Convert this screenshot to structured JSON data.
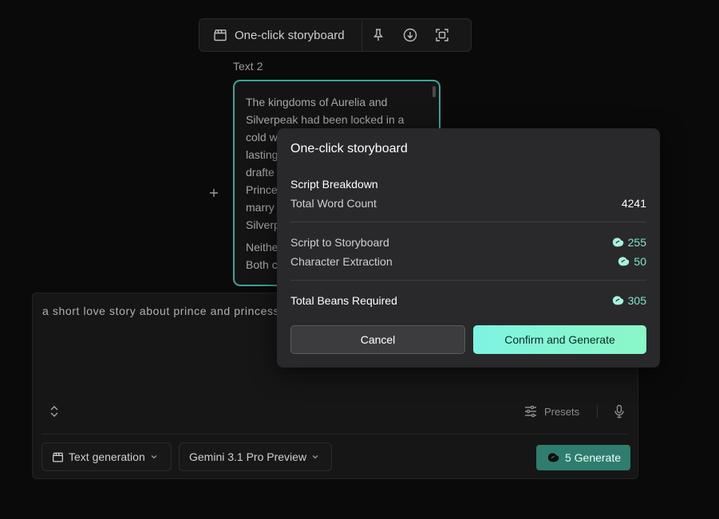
{
  "toolbar": {
    "title": "One-click storyboard",
    "icons": [
      "clapperboard-icon",
      "pin-icon",
      "download-icon",
      "fullscreen-icon"
    ]
  },
  "text_node": {
    "label": "Text 2",
    "paragraphs": [
      "The kingdoms of Aurelia and Silverpeak had been locked in a cold w lasting drafte Prince marry Silverp",
      "Neithe Both c"
    ],
    "lines": [
      "The kingdoms of Aurelia and",
      "Silverpeak had been locked in a",
      "cold w",
      "lasting",
      "drafte",
      "Prince",
      "marry",
      "Silverp"
    ],
    "lines2": [
      "Neithe",
      "Both c"
    ]
  },
  "prompt": {
    "text": "a short love story about prince and princess",
    "presets_label": "Presets",
    "mode_label": "Text generation",
    "model_label": "Gemini 3.1 Pro Preview",
    "generate_label": "5 Generate"
  },
  "modal": {
    "title": "One-click storyboard",
    "breakdown_label": "Script Breakdown",
    "word_count_label": "Total Word Count",
    "word_count_value": "4241",
    "storyboard_label": "Script to Storyboard",
    "storyboard_value": "255",
    "character_label": "Character Extraction",
    "character_value": "50",
    "total_label": "Total Beans Required",
    "total_value": "305",
    "cancel_label": "Cancel",
    "confirm_label": "Confirm and Generate"
  },
  "colors": {
    "accent_teal": "#3ea49a",
    "bean_color": "#7de8cf",
    "generate_bg": "#2f7d6e",
    "confirm_gradient_start": "#7ef3e2",
    "confirm_gradient_end": "#8bf7c6"
  }
}
